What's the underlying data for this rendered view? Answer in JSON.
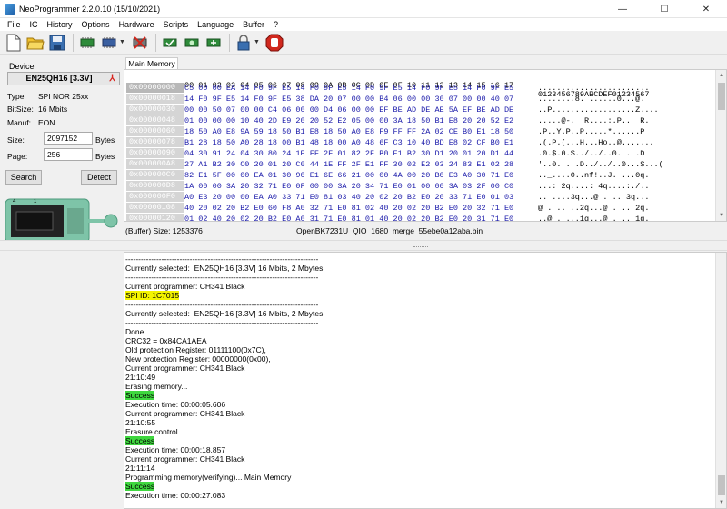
{
  "window": {
    "title": "NeoProgrammer 2.2.0.10 (15/10/2021)",
    "minimize": "—",
    "maximize": "☐",
    "close": "✕"
  },
  "menu": [
    "File",
    "IC",
    "History",
    "Options",
    "Hardware",
    "Scripts",
    "Language",
    "Buffer",
    "?"
  ],
  "toolbar": {
    "icons": [
      "new-file-icon",
      "open-folder-icon",
      "save-disk-icon",
      "read-chip-icon",
      "write-chip-icon",
      "erase-chip-icon",
      "verify-chip-icon",
      "blank-check-icon",
      "auto-chip-icon",
      "lock-icon",
      "stop-icon"
    ],
    "accent_stop": "#d0281e"
  },
  "device": {
    "label": "Device",
    "name": "EN25QH16 [3.3V]",
    "type_label": "Type:",
    "type_value": "SPI NOR 25xx",
    "bitsize_label": "BitSize:",
    "bitsize_value": "16 Mbits",
    "manuf_label": "Manuf:",
    "manuf_value": "EON",
    "size_label": "Size:",
    "size_value": "2097152",
    "size_unit": "Bytes",
    "page_label": "Page:",
    "page_value": "256",
    "page_unit": "Bytes",
    "search_button": "Search",
    "detect_button": "Detect"
  },
  "tab_main": "Main Memory",
  "hex": {
    "header_bytes": "00 01 02 03 04 05 06 07 08 09 0A 0B 0C 0D 0E 0F 10 11 12 13 14 15 16 17",
    "header_ascii": "0123456789ABCDEF01234567",
    "rows": [
      {
        "addr": "0x00000000",
        "bytes": "C5 00 00 EA 14 F0 9F E5 14 F0 9F E5 14 F0 9F E5 14 F0 9F E5 14 F0 9F E5",
        "ascii": "........................"
      },
      {
        "addr": "0x00000018",
        "bytes": "14 F0 9F E5 14 F0 9F E5 38 DA 20 07 00 00 B4 06 00 00 30 07 00 00 40 07",
        "ascii": "........8. ......0...@."
      },
      {
        "addr": "0x00000030",
        "bytes": "00 00 50 07 00 00 C4 06 00 00 D4 06 00 00 EF BE AD DE AE 5A EF BE AD DE",
        "ascii": "..P..................Z...."
      },
      {
        "addr": "0x00000048",
        "bytes": "01 00 00 00 10 40 2D E9 20 20 52 E2 05 00 00 3A 18 50 B1 E8 20 20 52 E2",
        "ascii": ".....@-.  R....:.P..  R."
      },
      {
        "addr": "0x00000060",
        "bytes": "18 50 A0 E8 9A 59 18 50 B1 E8 18 50 A0 E8 F9 FF FF 2A 02 CE B0 E1 18 50",
        "ascii": ".P..Y.P..P.....*......P"
      },
      {
        "addr": "0x00000078",
        "bytes": "B1 28 18 50 A0 28 18 00 B1 48 18 00 A0 48 6F C3 10 40 BD E8 02 CF B0 E1",
        "ascii": ".(.P.(...H...Ho..@......."
      },
      {
        "addr": "0x00000090",
        "bytes": "04 30 91 24 04 30 80 24 1E FF 2F 01 82 2F B0 E1 B2 30 D1 20 01 20 D1 44",
        "ascii": ".0.$.0.$../../..0. . .D"
      },
      {
        "addr": "0x000000A8",
        "bytes": "27 A1 B2 30 C0 20 01 20 C0 44 1E FF 2F E1 FF 30 02 E2 03 24 83 E1 02 28",
        "ascii": "'..0. . .D../../..0...$...("
      },
      {
        "addr": "0x000000C0",
        "bytes": "82 E1 5F 00 00 EA 01 30 90 E1 6E 66 21 00 00 4A 00 20 B0 E3 A0 30 71 E0",
        "ascii": ".._....0..nf!..J. ...0q."
      },
      {
        "addr": "0x000000D8",
        "bytes": "1A 00 00 3A 20 32 71 E0 0F 00 00 3A 20 34 71 E0 01 00 00 3A 03 2F 00 C0",
        "ascii": "...: 2q....: 4q....:./.."
      },
      {
        "addr": "0x000000F0",
        "bytes": "A0 E3 20 00 00 EA A0 33 71 E0 81 03 40 20 02 20 B2 E0 20 33 71 E0 01 03",
        "ascii": ".. ....3q...@ . .. 3q..."
      },
      {
        "addr": "0x00000108",
        "bytes": "40 20 02 20 B2 E0 60 F8 A0 32 71 E0 81 02 40 20 02 20 B2 E0 20 32 71 E0",
        "ascii": "@ . ..`..2q...@ . .. 2q."
      },
      {
        "addr": "0x00000120",
        "bytes": "01 02 40 20 02 20 B2 E0 A0 31 71 E0 81 01 40 20 02 20 B2 E0 20 31 71 E0",
        "ascii": "..@ . ...1q...@ . .. 1q."
      }
    ]
  },
  "status": {
    "size": "(Buffer) Size: 1253376",
    "file": "OpenBK7231U_QIO_1680_merge_55ebe0a12aba.bin"
  },
  "log": [
    {
      "text": "---------------------------------------------------------------------------",
      "hl": ""
    },
    {
      "text": "Currently selected:  EN25QH16 [3.3V] 16 Mbits, 2 Mbytes",
      "hl": ""
    },
    {
      "text": "---------------------------------------------------------------------------",
      "hl": ""
    },
    {
      "text": "Current programmer: CH341 Black",
      "hl": ""
    },
    {
      "text": "SPI ID: 1C7015",
      "hl": "yellow"
    },
    {
      "text": "---------------------------------------------------------------------------",
      "hl": ""
    },
    {
      "text": "Currently selected:  EN25QH16 [3.3V] 16 Mbits, 2 Mbytes",
      "hl": ""
    },
    {
      "text": "---------------------------------------------------------------------------",
      "hl": ""
    },
    {
      "text": "Done",
      "hl": ""
    },
    {
      "text": "CRC32 = 0x84CA1AEA",
      "hl": ""
    },
    {
      "text": "Old protection Register: 01111100(0x7C),",
      "hl": ""
    },
    {
      "text": "New protection Register: 00000000(0x00),",
      "hl": ""
    },
    {
      "text": "Current programmer: CH341 Black",
      "hl": ""
    },
    {
      "text": "21:10:49",
      "hl": ""
    },
    {
      "text": "Erasing memory...",
      "hl": ""
    },
    {
      "text": "Success",
      "hl": "green"
    },
    {
      "text": "Execution time: 00:00:05.606",
      "hl": ""
    },
    {
      "text": "Current programmer: CH341 Black",
      "hl": ""
    },
    {
      "text": "21:10:55",
      "hl": ""
    },
    {
      "text": "Erasure control...",
      "hl": ""
    },
    {
      "text": "Success",
      "hl": "green"
    },
    {
      "text": "Execution time: 00:00:18.857",
      "hl": ""
    },
    {
      "text": "Current programmer: CH341 Black",
      "hl": ""
    },
    {
      "text": "21:11:14",
      "hl": ""
    },
    {
      "text": "Programming memory(verifying)... Main Memory",
      "hl": ""
    },
    {
      "text": "Success",
      "hl": "green"
    },
    {
      "text": "Execution time: 00:00:27.083",
      "hl": ""
    }
  ],
  "colors": {
    "highlight_yellow": "#f4f400",
    "highlight_green": "#3fd73f",
    "hex_bytes": "#1a1aaa"
  }
}
